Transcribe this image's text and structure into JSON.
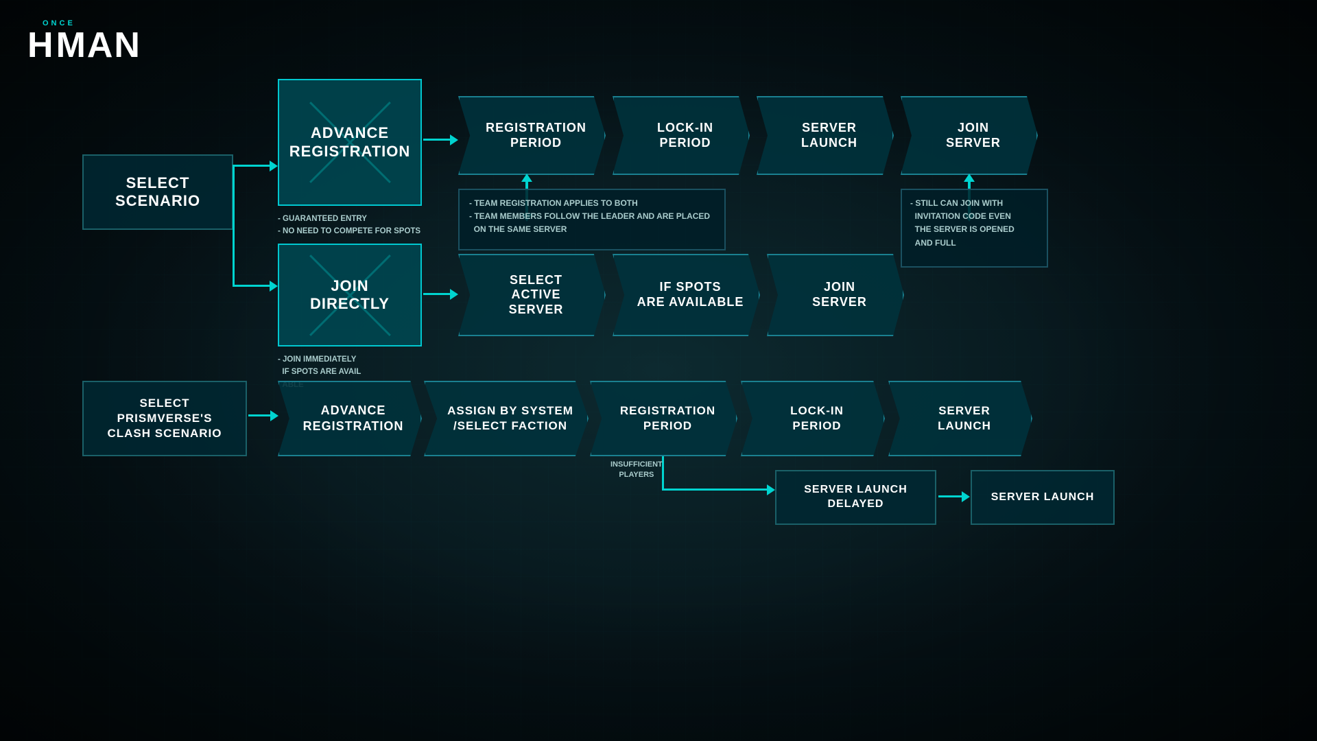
{
  "logo": {
    "once": "ONCE",
    "human": "HUM N",
    "tagline": "ONCE HUMAN"
  },
  "upper": {
    "selectScenario": "SELECT\nSCENARIO",
    "advanceReg": "ADVANCE\nREGISTRATION",
    "joinDirectly": "JOIN\nDIRECTLY",
    "advanceRegNotes": "- GUARANTEED ENTRY\n- NO NEED TO COMPETE\n  FOR SPOTS",
    "joinDirectlyNotes": "- JOIN IMMEDIATELY\n  IF SPOTS ARE AVAIL\n  ABLE",
    "teamRegInfo": "- TEAM REGISTRATION APPLIES TO BOTH\n- TEAM MEMBERS FOLLOW THE LEADER AND ARE PLACED\n  ON THE SAME SERVER",
    "invitationInfo": "- STILL CAN JOIN WITH\n  INVITATION CODE EVEN\n  THE SERVER IS OPENED\n  AND FULL",
    "regPeriod": "REGISTRATION\nPERIOD",
    "lockInPeriod": "LOCK-IN\nPERIOD",
    "serverLaunch": "SERVER\nLAUNCH",
    "joinServer1": "JOIN\nSERVER",
    "selectActiveServer": "SELECT\nACTIVE\nSERVER",
    "ifSpotsAvailable": "IF SPOTS\nARE AVAILABLE",
    "joinServer2": "JOIN\nSERVER"
  },
  "lower": {
    "selectPrismverse": "SELECT\nPRISMVERSE'S\nCLASH SCENARIO",
    "advanceReg": "ADVANCE\nREGISTRATION",
    "assignFaction": "ASSIGN BY SYSTEM\n/SELECT FACTION",
    "regPeriod": "REGISTRATION\nPERIOD",
    "lockInPeriod": "LOCK-IN\nPERIOD",
    "serverLaunch": "SERVER\nLAUNCH",
    "insufficientPlayers": "INSUFFICIENT\nPLAYERS",
    "serverLaunchDelayed": "SERVER LAUNCH\nDELAYED",
    "serverLaunch2": "SERVER\nLAUNCH"
  }
}
